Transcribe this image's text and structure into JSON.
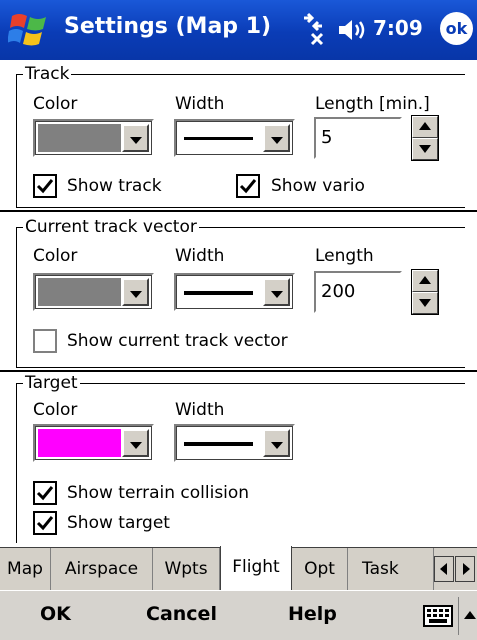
{
  "titlebar": {
    "title": "Settings (Map 1)",
    "time": "7:09",
    "ok": "ok"
  },
  "track": {
    "legend": "Track",
    "color_label": "Color",
    "width_label": "Width",
    "length_label": "Length [min.]",
    "color_value": "#808080",
    "length_value": "5",
    "show_track_label": "Show track",
    "show_track_checked": true,
    "show_vario_label": "Show vario",
    "show_vario_checked": true
  },
  "vector": {
    "legend": "Current track vector",
    "color_label": "Color",
    "width_label": "Width",
    "length_label": "Length",
    "color_value": "#808080",
    "length_value": "200",
    "show_label": "Show current track vector",
    "show_checked": false
  },
  "target": {
    "legend": "Target",
    "color_label": "Color",
    "width_label": "Width",
    "color_value": "#ff00ff",
    "terrain_label": "Show terrain collision",
    "terrain_checked": true,
    "show_label": "Show target",
    "show_checked": true
  },
  "tabs": [
    {
      "label": "Map"
    },
    {
      "label": "Airspace"
    },
    {
      "label": "Wpts"
    },
    {
      "label": "Flight",
      "active": true
    },
    {
      "label": "Opt"
    },
    {
      "label": "Task"
    }
  ],
  "menu": {
    "ok": "OK",
    "cancel": "Cancel",
    "help": "Help"
  }
}
